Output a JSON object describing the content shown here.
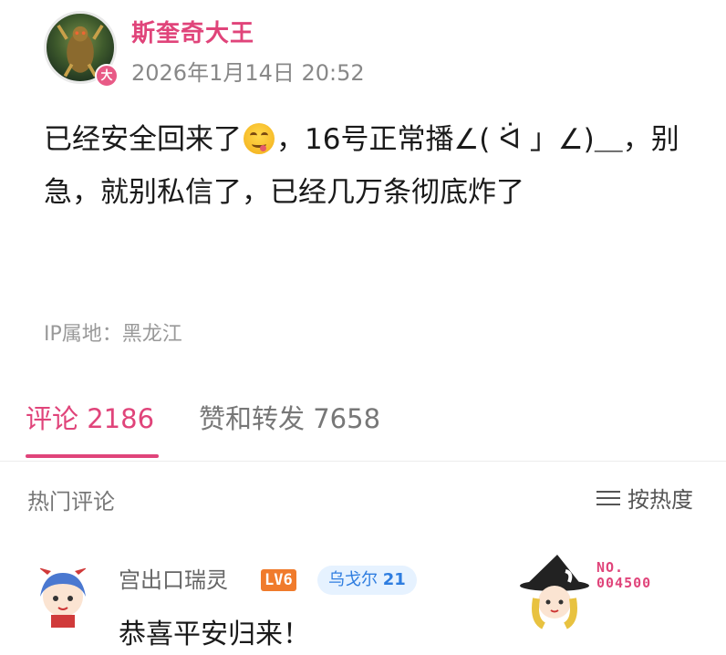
{
  "post": {
    "username": "斯奎奇大王",
    "vip_badge": "大",
    "timestamp": "2026年1月14日 20:52",
    "text_part1": "已经安全回来了",
    "text_part2": "，16号正常播∠( ᐛ 」∠)＿，别急，就别私信了，已经几万条彻底炸了",
    "emoji_icon": "yum-face-emoji",
    "ip_location": "IP属地：黑龙江"
  },
  "tabs": {
    "comments": "评论 2186",
    "reposts": "赞和转发 7658"
  },
  "hot_comments": {
    "title": "热门评论",
    "sort_label": "按热度",
    "sort_icon": "menu-icon"
  },
  "comments": [
    {
      "username": "宫出口瑞灵",
      "level": "LV6",
      "fan_badge_name": "乌戈尔",
      "fan_badge_level": "21",
      "text": "恭喜平安归来！",
      "decoration_number_label": "NO.",
      "decoration_number": "004500"
    }
  ],
  "colors": {
    "accent": "#e0447a",
    "level_badge": "#f07b2c",
    "fan_badge_bg": "#e6f2ff",
    "fan_badge_text": "#2e7de0"
  }
}
